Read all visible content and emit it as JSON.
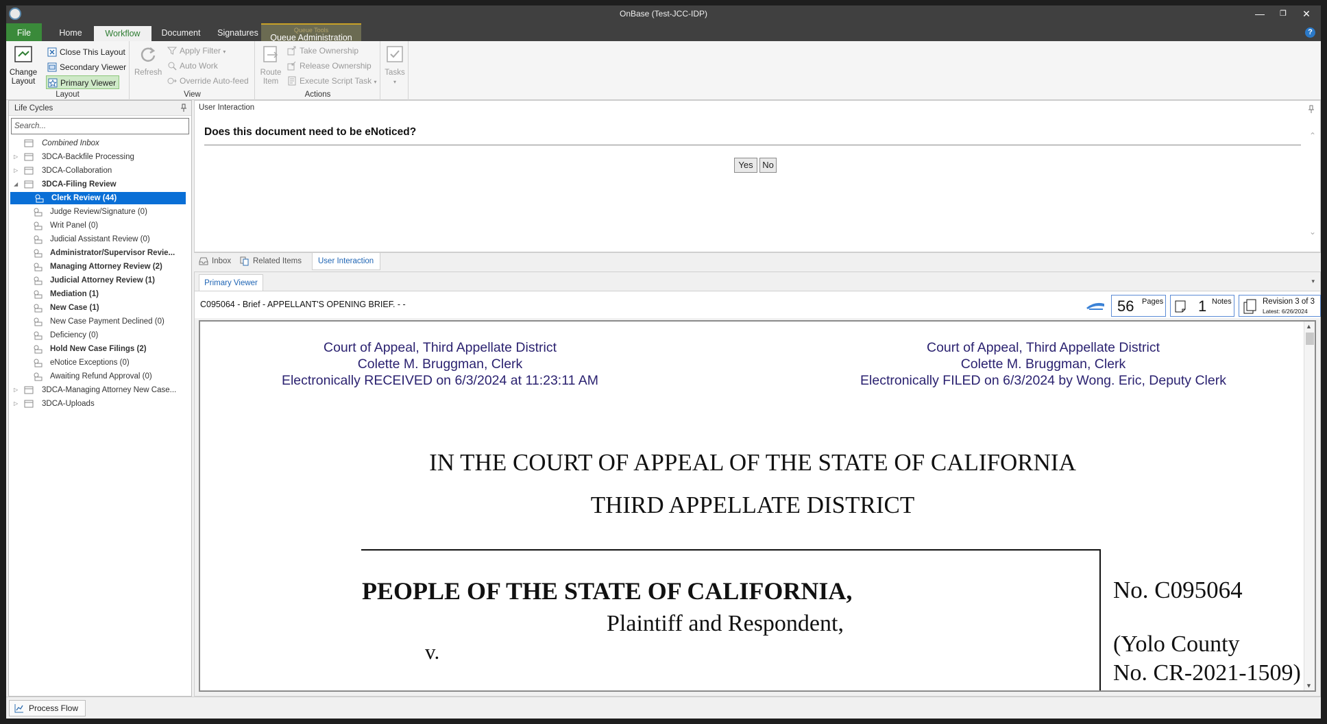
{
  "window": {
    "title": "OnBase (Test-JCC-IDP)",
    "controls": [
      "minimize",
      "restore",
      "close"
    ]
  },
  "ribbon_tabs": {
    "file": "File",
    "home": "Home",
    "workflow": "Workflow",
    "document": "Document",
    "signatures": "Signatures",
    "contextual_group": "Queue Tools",
    "queue_admin": "Queue Administration"
  },
  "ribbon": {
    "layout": {
      "label": "Layout",
      "change_layout": "Change Layout",
      "close_layout": "Close This Layout",
      "secondary_viewer": "Secondary Viewer",
      "primary_viewer": "Primary Viewer"
    },
    "view": {
      "label": "View",
      "refresh": "Refresh",
      "apply_filter": "Apply Filter",
      "auto_work": "Auto Work",
      "override_autofeed": "Override Auto-feed"
    },
    "actions": {
      "label": "Actions",
      "route_item": "Route Item",
      "take_ownership": "Take Ownership",
      "release_ownership": "Release Ownership",
      "execute_script": "Execute Script Task"
    },
    "tasks": "Tasks"
  },
  "lifecycles": {
    "header": "Life Cycles",
    "search_placeholder": "Search...",
    "items": [
      {
        "label": "Combined Inbox",
        "level": 0
      },
      {
        "label": "3DCA-Backfile Processing",
        "level": 0
      },
      {
        "label": "3DCA-Collaboration",
        "level": 0
      },
      {
        "label": "3DCA-Filing Review",
        "level": 0
      },
      {
        "label": "Clerk Review (44)",
        "level": 1,
        "selected": true
      },
      {
        "label": "Judge Review/Signature (0)",
        "level": 1
      },
      {
        "label": "Writ Panel (0)",
        "level": 1
      },
      {
        "label": "Judicial Assistant Review (0)",
        "level": 1
      },
      {
        "label": "Administrator/Supervisor Revie...",
        "level": 1
      },
      {
        "label": "Managing Attorney Review (2)",
        "level": 1
      },
      {
        "label": "Judicial Attorney Review (1)",
        "level": 1
      },
      {
        "label": "Mediation (1)",
        "level": 1
      },
      {
        "label": "New Case (1)",
        "level": 1
      },
      {
        "label": "New Case Payment Declined (0)",
        "level": 1
      },
      {
        "label": "Deficiency (0)",
        "level": 1
      },
      {
        "label": "Hold New Case Filings (2)",
        "level": 1
      },
      {
        "label": "eNotice Exceptions (0)",
        "level": 1
      },
      {
        "label": "Awaiting Refund Approval (0)",
        "level": 1
      },
      {
        "label": "3DCA-Managing Attorney New Case...",
        "level": 0
      },
      {
        "label": "3DCA-Uploads",
        "level": 0
      }
    ]
  },
  "user_interaction": {
    "header": "User Interaction",
    "question": "Does this document need to be eNoticed?",
    "yes": "Yes",
    "no": "No"
  },
  "bottom_tabs": {
    "inbox": "Inbox",
    "related": "Related Items",
    "ui": "User Interaction"
  },
  "viewer": {
    "tab": "Primary Viewer",
    "doc_title": "C095064 - Brief - APPELLANT'S OPENING BRIEF. -  -",
    "pages_count": "56",
    "pages_label": "Pages",
    "notes_count": "1",
    "notes_label": "Notes",
    "revision": "Revision 3 of 3",
    "revision_latest": "Latest: 6/26/2024"
  },
  "document": {
    "stamp_left": [
      "Court of Appeal, Third Appellate District",
      "Colette M. Bruggman, Clerk",
      "Electronically RECEIVED on 6/3/2024 at 11:23:11 AM"
    ],
    "stamp_right": [
      "Court of Appeal, Third Appellate District",
      "Colette M. Bruggman, Clerk",
      "Electronically FILED on 6/3/2024 by Wong. Eric, Deputy Clerk"
    ],
    "court_line1": "IN THE COURT OF APPEAL OF THE STATE OF CALIFORNIA",
    "court_line2": "THIRD APPELLATE DISTRICT",
    "party1": "PEOPLE OF THE STATE OF CALIFORNIA,",
    "party1_role": "Plaintiff and Respondent,",
    "versus": "v.",
    "case_no": "No. C095064",
    "county_line1": "(Yolo County",
    "county_line2": "No. CR-2021-1509)"
  },
  "statusbar": {
    "process_flow": "Process Flow"
  },
  "colors": {
    "accent_green": "#2e7d32",
    "selection_blue": "#0a6fd6",
    "stamp_text": "#2b2270"
  }
}
